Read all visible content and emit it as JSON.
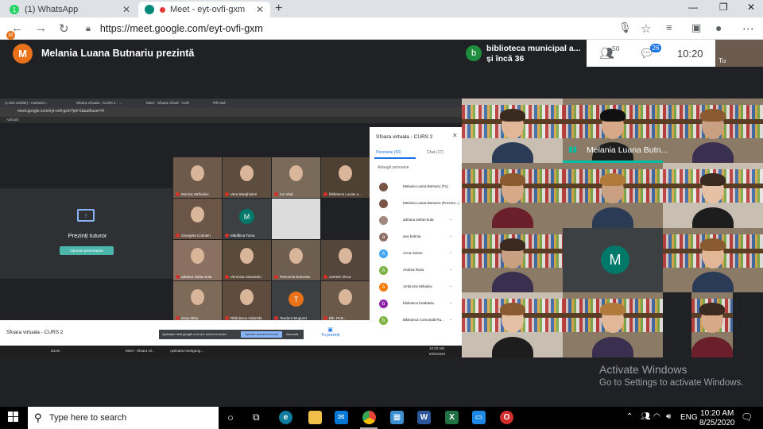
{
  "browser": {
    "tabs": [
      {
        "title": "(1) WhatsApp",
        "active": false
      },
      {
        "title": "Meet - eyt-ovfi-gxm",
        "active": true
      }
    ],
    "url": "https://meet.google.com/eyt-ovfi-gxm"
  },
  "meet": {
    "presenter_initial": "M",
    "presenter_label": "Melania Luana Butnariu prezintă",
    "participant_chip": {
      "initial": "b",
      "line1": "biblioteca municipal a...",
      "line2": "și încă 36"
    },
    "people_count": "50",
    "chat_count": "26",
    "time": "10:20",
    "self_label": "Tu",
    "speaker_label": "Melania Luana Butn...",
    "tile_initial": "M"
  },
  "shared_screen": {
    "tabs": [
      "(1.503 nedtite) - melania.l...",
      "Sfoara virtuala - CURS 2 - ...",
      "Meet - Sfoara virtual - CUR",
      "Pill mail"
    ],
    "url": "meet.google.com/eyt-ovfi-gxm?pli=1&authuser=0",
    "bookmark": "Aplicații",
    "presenting_label": "Tu prezinți",
    "present_title": "Prezinți tuturor",
    "stop_button": "Oprește prezentarea",
    "meeting_name": "Sfoara virtuala - CURS 2",
    "notice_text": "Aplicația meet.google.com are acces la ecran.",
    "notice_button": "Oprește accesul la ecran",
    "notice_hide": "Ascunde",
    "presenting_button": "Tu prezinți",
    "grid": [
      {
        "name": "Monica Strihoriuc",
        "initial": ""
      },
      {
        "name": "Vera Sterghiuleri",
        "initial": ""
      },
      {
        "name": "Ion Vlad",
        "initial": ""
      },
      {
        "name": "biblioteca Lucian a...",
        "initial": ""
      },
      {
        "name": "Georgeta Cobuleri",
        "initial": ""
      },
      {
        "name": "Mădălina Toma",
        "initial": "M"
      },
      {
        "name": "",
        "initial": ""
      },
      {
        "name": "",
        "initial": ""
      },
      {
        "name": "adriana stefan-tiuta",
        "initial": ""
      },
      {
        "name": "Veronica Alexandru",
        "initial": ""
      },
      {
        "name": "Petronela Botezatu",
        "initial": ""
      },
      {
        "name": "carmen Vinca",
        "initial": ""
      },
      {
        "name": "Sony Mitia",
        "initial": ""
      },
      {
        "name": "Rădulescu Gabriela",
        "initial": ""
      },
      {
        "name": "Teodora Muguret",
        "initial": "T"
      },
      {
        "name": "Bib. PAR...",
        "initial": ""
      }
    ],
    "people_panel": {
      "title": "Sfoara virtuala - CURS 2",
      "tab_people": "Persoane (50)",
      "tab_chat": "Chat (17)",
      "add": "Adaugă persoane",
      "rows": [
        {
          "name": "Melania Luana Butnariu (Tu)",
          "initial": "",
          "color": "#795548"
        },
        {
          "name": "Melania Luana Butnariu (Prezent...)",
          "initial": "",
          "color": "#795548"
        },
        {
          "name": "adriana stefan-tiuta",
          "initial": "",
          "color": "#a1887f"
        },
        {
          "name": "ana bahnia",
          "initial": "a",
          "color": "#8d6e63"
        },
        {
          "name": "Anca Gainei",
          "initial": "A",
          "color": "#42a5f5"
        },
        {
          "name": "Andrea Rusu",
          "initial": "A",
          "color": "#7cb342"
        },
        {
          "name": "Ambrozie Mihailov",
          "initial": "A",
          "color": "#f57c00"
        },
        {
          "name": "biblioteca bradatelu",
          "initial": "b",
          "color": "#8e24aa"
        },
        {
          "name": "Biblioteca Comunală Ru...",
          "initial": "b",
          "color": "#7cb342"
        }
      ]
    },
    "taskbar": [
      "Zoom",
      "Meet - Sfoara vir...",
      "Aplicatia meetgoog...",
      "10:20 AM",
      "8/25/2020"
    ]
  },
  "watermark": {
    "title": "Activate Windows",
    "subtitle": "Go to Settings to activate Windows."
  },
  "taskbar": {
    "search_placeholder": "Type here to search",
    "lang": "ENG",
    "time": "10:20 AM",
    "date": "8/25/2020"
  }
}
